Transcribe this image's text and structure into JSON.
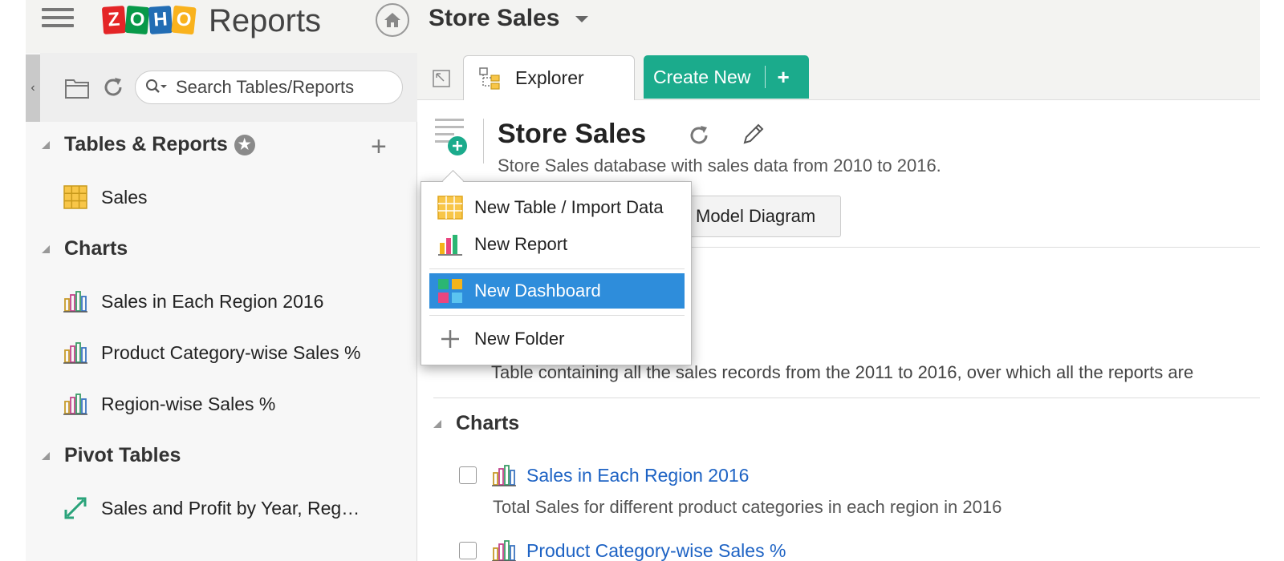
{
  "header": {
    "logo_letters": [
      "Z",
      "O",
      "H",
      "O"
    ],
    "app_title": "Reports",
    "database_title": "Store Sales"
  },
  "sidebar": {
    "search_placeholder": "Search Tables/Reports",
    "sections": [
      {
        "title": "Tables & Reports",
        "items": [
          {
            "label": "Sales",
            "icon": "table-icon"
          }
        ]
      },
      {
        "title": "Charts",
        "items": [
          {
            "label": "Sales in Each Region 2016",
            "icon": "chart-icon"
          },
          {
            "label": "Product Category-wise Sales %",
            "icon": "chart-icon"
          },
          {
            "label": "Region-wise Sales %",
            "icon": "chart-icon"
          }
        ]
      },
      {
        "title": "Pivot Tables",
        "items": [
          {
            "label": "Sales and Profit by Year, Reg…",
            "icon": "pivot-icon"
          }
        ]
      }
    ]
  },
  "tabs": {
    "explorer_label": "Explorer",
    "create_new_label": "Create New",
    "create_new_plus": "+"
  },
  "main": {
    "title": "Store Sales",
    "description": "Store Sales database with sales data from 2010 to 2016.",
    "model_diagram_label": "Model Diagram",
    "table_description": "Table containing all the sales records from the 2011 to 2016, over which all the reports are",
    "charts_heading": "Charts",
    "chart_items": [
      {
        "label": "Sales in Each Region 2016",
        "description": "Total Sales for different product categories in each region in 2016"
      },
      {
        "label": "Product Category-wise Sales %"
      }
    ]
  },
  "dropdown": {
    "items": [
      {
        "label": "New Table / Import Data",
        "icon": "table-grid-icon"
      },
      {
        "label": "New Report",
        "icon": "bar-chart-icon"
      },
      {
        "label": "New Dashboard",
        "icon": "dashboard-icon",
        "active": true
      },
      {
        "label": "New Folder",
        "icon": "plus-icon"
      }
    ]
  },
  "colors": {
    "accent_green": "#1bab8c",
    "highlight_blue": "#2e8ddb",
    "link_blue": "#1e63c4",
    "zoho_red": "#e42527",
    "zoho_green": "#089949",
    "zoho_blue": "#226db4",
    "zoho_yellow": "#f9b21d"
  }
}
